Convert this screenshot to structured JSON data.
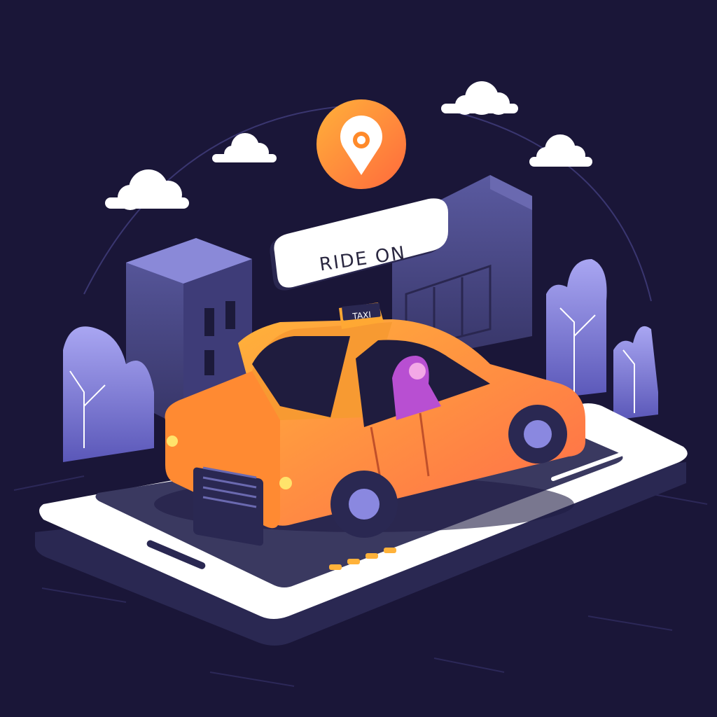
{
  "banner": {
    "text": "RIDE ON"
  },
  "taxi": {
    "sign": "TAXI"
  },
  "icons": {
    "pin": "location-pin-icon",
    "cloud": "cloud-icon"
  },
  "colors": {
    "background": "#1a1638",
    "taxi_orange": "#f79a32",
    "pin_orange": "#ff8a2a",
    "building": "#4a4a8a",
    "tree": "#8a88e0",
    "phone": "#ffffff",
    "road": "#3a3960"
  }
}
